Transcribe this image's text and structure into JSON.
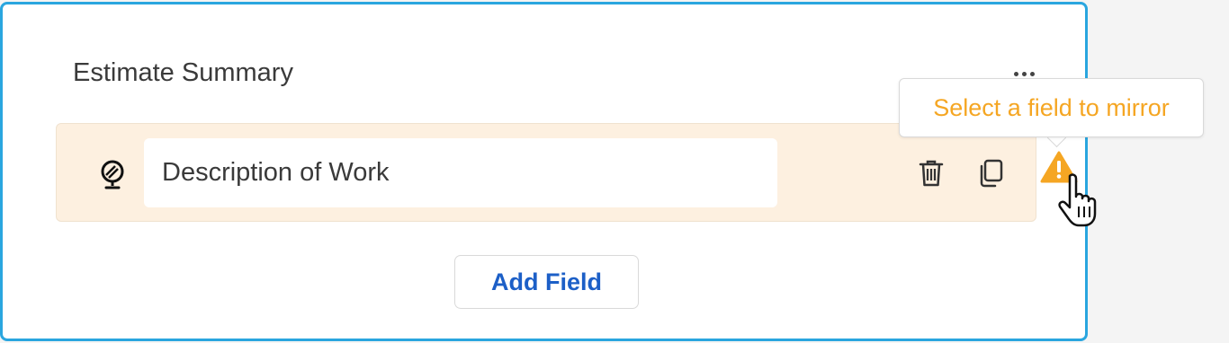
{
  "section": {
    "title": "Estimate Summary",
    "more_icon": "ellipsis-horizontal-icon"
  },
  "field": {
    "type_icon": "globe-stand-icon",
    "value": "Description of Work",
    "delete_icon": "trash-icon",
    "duplicate_icon": "copy-icon",
    "status_icon": "warning-triangle-icon"
  },
  "tooltip": {
    "text": "Select a field to mirror"
  },
  "actions": {
    "add_field_label": "Add Field"
  },
  "colors": {
    "card_border": "#2aa6df",
    "row_background": "#fdf0e0",
    "warning": "#f5a623",
    "link_blue": "#1c5fc7"
  }
}
